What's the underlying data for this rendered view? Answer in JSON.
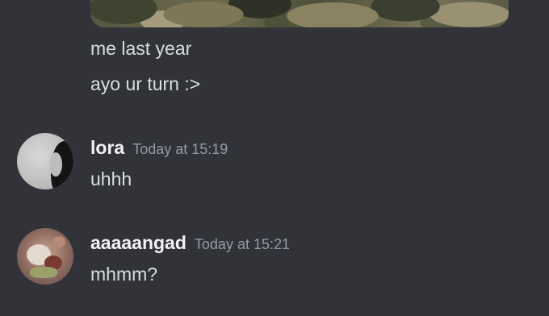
{
  "messages": {
    "prev_lines": [
      "me last year",
      "ayo ur turn :>"
    ],
    "lora": {
      "username": "lora",
      "timestamp": "Today at 15:19",
      "text": "uhhh"
    },
    "angad": {
      "username": "aaaaangad",
      "timestamp": "Today at 15:21",
      "text": "mhmm?"
    }
  },
  "colors": {
    "background": "#313338",
    "text": "#dbdee1",
    "username": "#f2f3f5",
    "timestamp": "#949ba4"
  }
}
